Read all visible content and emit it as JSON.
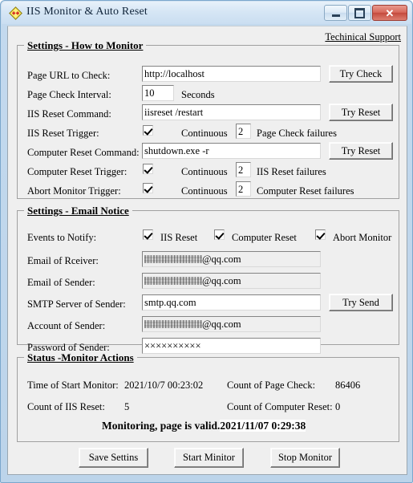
{
  "window": {
    "title": "IIS Monitor & Auto Reset",
    "icon": "app-diamond-icon",
    "minimize_label": "",
    "maximize_label": "",
    "close_label": "✕",
    "frame_color": "#c3d9ee",
    "client_bg": "#efefef"
  },
  "header": {
    "tech_support_link": "Techinical Support"
  },
  "monitor_group": {
    "title": "Settings - How to Monitor",
    "rows": {
      "page_url": {
        "label": "Page URL to Check:",
        "value": "http://localhost",
        "button": "Try Check"
      },
      "interval": {
        "label": "Page Check Interval:",
        "value": "10",
        "unit": "Seconds"
      },
      "iis_reset_cmd": {
        "label": "IIS Reset Command:",
        "value": "iisreset /restart",
        "button": "Try Reset"
      },
      "iis_reset_trigger": {
        "label": "IIS Reset Trigger:",
        "checked": true,
        "continuous": "Continuous",
        "count": "2",
        "suffix": "Page Check failures"
      },
      "computer_reset_cmd": {
        "label": "Computer Reset Command:",
        "value": "shutdown.exe -r",
        "button": "Try Reset"
      },
      "computer_reset_trigger": {
        "label": "Computer Reset Trigger:",
        "checked": true,
        "continuous": "Continuous",
        "count": "2",
        "suffix": "IIS Reset failures"
      },
      "abort_monitor_trigger": {
        "label": "Abort Monitor Trigger:",
        "checked": true,
        "continuous": "Continuous",
        "count": "2",
        "suffix": "Computer Reset failures"
      }
    }
  },
  "email_group": {
    "title": "Settings - Email Notice",
    "events_label": "Events to Notify:",
    "events": [
      {
        "label": "IIS Reset",
        "checked": true
      },
      {
        "label": "Computer Reset",
        "checked": true
      },
      {
        "label": "Abort Monitor",
        "checked": true
      }
    ],
    "rows": {
      "receiver": {
        "label": "Email of Rceiver:",
        "value_redacted": true,
        "value_visible": "@qq.com"
      },
      "sender": {
        "label": "Email of Sender:",
        "value_redacted": true,
        "value_visible": "@qq.com",
        "button": "Try Send"
      },
      "smtp": {
        "label": "SMTP Server of Sender:",
        "value": "smtp.qq.com"
      },
      "account": {
        "label": "Account of Sender:",
        "value_redacted": true,
        "value_visible": "@qq.com"
      },
      "password": {
        "label": "Password of Sender:",
        "value": "××××××××××"
      }
    }
  },
  "status_group": {
    "title": "Status -Monitor Actions",
    "fields": [
      {
        "label": "Time of Start Monitor:",
        "value": "2021/10/7 00:23:02"
      },
      {
        "label": "Count of Page Check:",
        "value": "86406"
      },
      {
        "label": "Count of IIS Reset:",
        "value": "5"
      },
      {
        "label": "Count of Computer Reset:",
        "value": "0"
      }
    ],
    "status_message": "Monitoring, page is valid.",
    "status_timestamp": "2021/11/07  0:29:38"
  },
  "footer": {
    "save_button": "Save Settins",
    "start_button": "Start Minitor",
    "stop_button": "Stop Monitor"
  }
}
